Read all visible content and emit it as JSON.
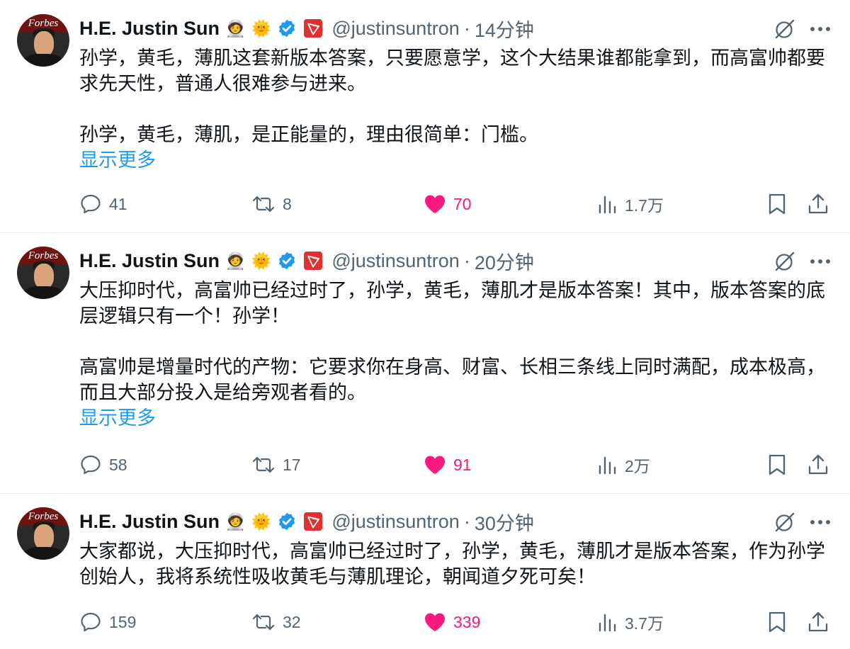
{
  "tweets": [
    {
      "author": "H.E. Justin Sun",
      "handle": "@justinsuntron",
      "separator": "·",
      "time": "14分钟",
      "avatar_text": "Forbes",
      "emoji": [
        "🧑‍🚀",
        "🌞"
      ],
      "paragraphs": [
        "孙学，黄毛，薄肌这套新版本答案，只要愿意学，这个大结果谁都能拿到，而高富帅都要求先天性，普通人很难参与进来。",
        "孙学，黄毛，薄肌，是正能量的，理由很简单：门槛。"
      ],
      "show_more": "显示更多",
      "replies": "41",
      "retweets": "8",
      "likes": "70",
      "views": "1.7万"
    },
    {
      "author": "H.E. Justin Sun",
      "handle": "@justinsuntron",
      "separator": "·",
      "time": "20分钟",
      "avatar_text": "Forbes",
      "emoji": [
        "🧑‍🚀",
        "🌞"
      ],
      "paragraphs": [
        "大压抑时代，高富帅已经过时了，孙学，黄毛，薄肌才是版本答案！其中，版本答案的底层逻辑只有一个！孙学！",
        "高富帅是增量时代的产物：它要求你在身高、财富、长相三条线上同时满配，成本极高，而且大部分投入是给旁观者看的。"
      ],
      "show_more": "显示更多",
      "replies": "58",
      "retweets": "17",
      "likes": "91",
      "views": "2万"
    },
    {
      "author": "H.E. Justin Sun",
      "handle": "@justinsuntron",
      "separator": "·",
      "time": "30分钟",
      "avatar_text": "Forbes",
      "emoji": [
        "🧑‍🚀",
        "🌞"
      ],
      "paragraphs": [
        "大家都说，大压抑时代，高富帅已经过时了，孙学，黄毛，薄肌才是版本答案，作为孙学创始人，我将系统性吸收黄毛与薄肌理论，朝闻道夕死可矣！"
      ],
      "replies": "159",
      "retweets": "32",
      "likes": "339",
      "views": "3.7万"
    }
  ],
  "icons": {
    "verified": "verified-badge-icon",
    "tron": "tron-logo-icon",
    "grok": "grok-icon",
    "more": "more-options-icon",
    "reply": "reply-icon",
    "retweet": "retweet-icon",
    "like": "heart-icon",
    "views": "views-icon",
    "bookmark": "bookmark-icon",
    "share": "share-icon"
  },
  "colors": {
    "accent": "#1d9bf0",
    "like": "#f91880",
    "muted": "#536471",
    "text": "#0f1419",
    "tron": "#e0312e"
  }
}
